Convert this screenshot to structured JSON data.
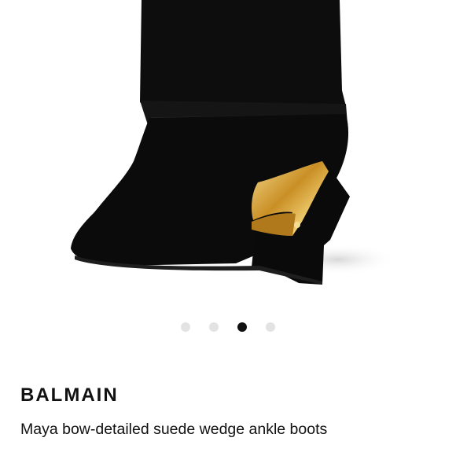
{
  "product": {
    "brand": "BALMAIN",
    "title": "Maya bow-detailed suede wedge ankle boots"
  },
  "carousel": {
    "dots": [
      {
        "label": "image 1",
        "active": false
      },
      {
        "label": "image 2",
        "active": false
      },
      {
        "label": "image 3",
        "active": true
      },
      {
        "label": "image 4",
        "active": false
      }
    ],
    "active_index": 2
  },
  "colors": {
    "boot": "#0b0b0b",
    "hardware_gold": "#d9a640",
    "dot_inactive": "#e3e3e3",
    "dot_active": "#111111",
    "text": "#111111"
  }
}
